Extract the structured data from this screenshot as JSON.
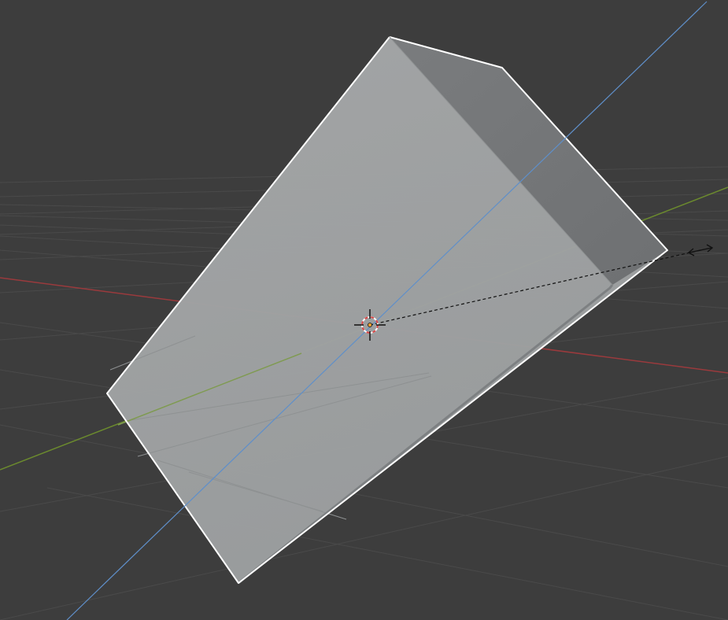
{
  "viewport": {
    "mode": "3d-viewport",
    "transform": "rotate",
    "background_color": "#3d3d3d"
  },
  "colors": {
    "grid": "#4a4a4a",
    "axis_x": "#9a3a3d",
    "axis_y": "#6b8a2e",
    "axis_z": "#5f8fc9",
    "face_front": "#a2a5a6",
    "face_side": "#76787a",
    "outline": "#ffffff",
    "rotate_line": "#111111"
  },
  "icons": {
    "object_origin": "origin-icon",
    "cursor_3d": "3d-cursor-icon",
    "transform_cursor": "rotate-cursor-icon"
  }
}
